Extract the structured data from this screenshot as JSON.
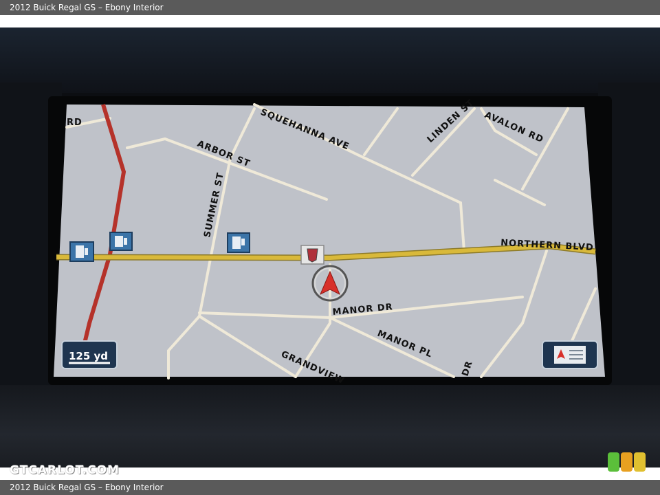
{
  "header": {
    "title": "2012 Buick Regal GS – Ebony Interior"
  },
  "footer": {
    "title": "2012 Buick Regal GS – Ebony Interior"
  },
  "watermark": {
    "text": "GTCARLOT.COM"
  },
  "map": {
    "streets": {
      "rd_edge": "RD",
      "susquehanna": "SQUEHANNA AVE",
      "linden": "LINDEN ST",
      "avalon": "AVALON RD",
      "arbor": "ARBOR ST",
      "summer": "SUMMER ST",
      "northern": "NORTHERN BLVD",
      "manor_dr": "MANOR DR",
      "manor_pl": "MANOR PL",
      "grandview": "GRANDVIEW",
      "dr_edge": "DR"
    },
    "scale_value": "125 yd",
    "colors": {
      "map_bg": "#bfc2c9",
      "street": "#efe9d8",
      "main_road": "#d9b93a",
      "highway": "#b5322a",
      "vehicle_arrow": "#d8302a"
    },
    "icons": [
      "gas-station-icon",
      "cadillac-poi-icon",
      "vehicle-position-icon",
      "map-view-icon"
    ]
  },
  "badge_colors": [
    "#5bbf3a",
    "#e8a020",
    "#e0c030"
  ]
}
